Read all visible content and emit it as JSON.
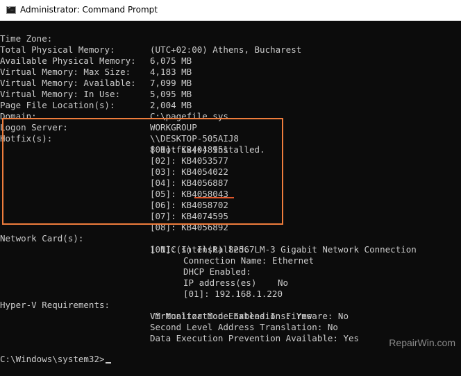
{
  "window": {
    "title": "Administrator: Command Prompt",
    "icon": "cmd-icon"
  },
  "system": {
    "time_zone": {
      "label": "Time Zone:",
      "value": "(UTC+02:00) Athens, Bucharest"
    },
    "total_physical_memory": {
      "label": "Total Physical Memory:",
      "value": "6,075 MB"
    },
    "available_physical_memory": {
      "label": "Available Physical Memory:",
      "value": "4,183 MB"
    },
    "vm_max_size": {
      "label": "Virtual Memory: Max Size:",
      "value": "7,099 MB"
    },
    "vm_available": {
      "label": "Virtual Memory: Available:",
      "value": "5,095 MB"
    },
    "vm_in_use": {
      "label": "Virtual Memory: In Use:",
      "value": "2,004 MB"
    },
    "page_file": {
      "label": "Page File Location(s):",
      "value": "C:\\pagefile.sys"
    },
    "domain": {
      "label": "Domain:",
      "value": "WORKGROUP"
    },
    "logon_server": {
      "label": "Logon Server:",
      "value": "\\\\DESKTOP-505AIJ8"
    }
  },
  "hotfixes": {
    "label": "Hotfix(s):",
    "summary": "8 Hotfix(s) Installed.",
    "items": [
      "[01]: KB4048951",
      "[02]: KB4053577",
      "[03]: KB4054022",
      "[04]: KB4056887",
      "[05]: KB4058043",
      "[06]: KB4058702",
      "[07]: KB4074595",
      "[08]: KB4056892"
    ]
  },
  "network": {
    "label": "Network Card(s):",
    "summary": "1 NIC(s) Installed.",
    "adapter": "[01]: Intel(R) 82567LM-3 Gigabit Network Connection",
    "connection_name": "Connection Name: Ethernet",
    "dhcp_label": "DHCP Enabled:",
    "dhcp_value": "No",
    "ip_header": "IP address(es)",
    "ip_1": "[01]: 192.168.1.220"
  },
  "hyperv": {
    "label": "Hyper-V Requirements:",
    "items": [
      "VM Monitor Mode Extensions: Yes",
      "Virtualization Enabled In Firmware: No",
      "Second Level Address Translation: No",
      "Data Execution Prevention Available: Yes"
    ]
  },
  "prompt": "C:\\Windows\\system32>",
  "watermark": "RepairWin.com",
  "colors": {
    "background": "#0c0c0c",
    "text": "#cccccc",
    "highlight_box": "#ef7d3c",
    "underline": "#e0562a"
  }
}
